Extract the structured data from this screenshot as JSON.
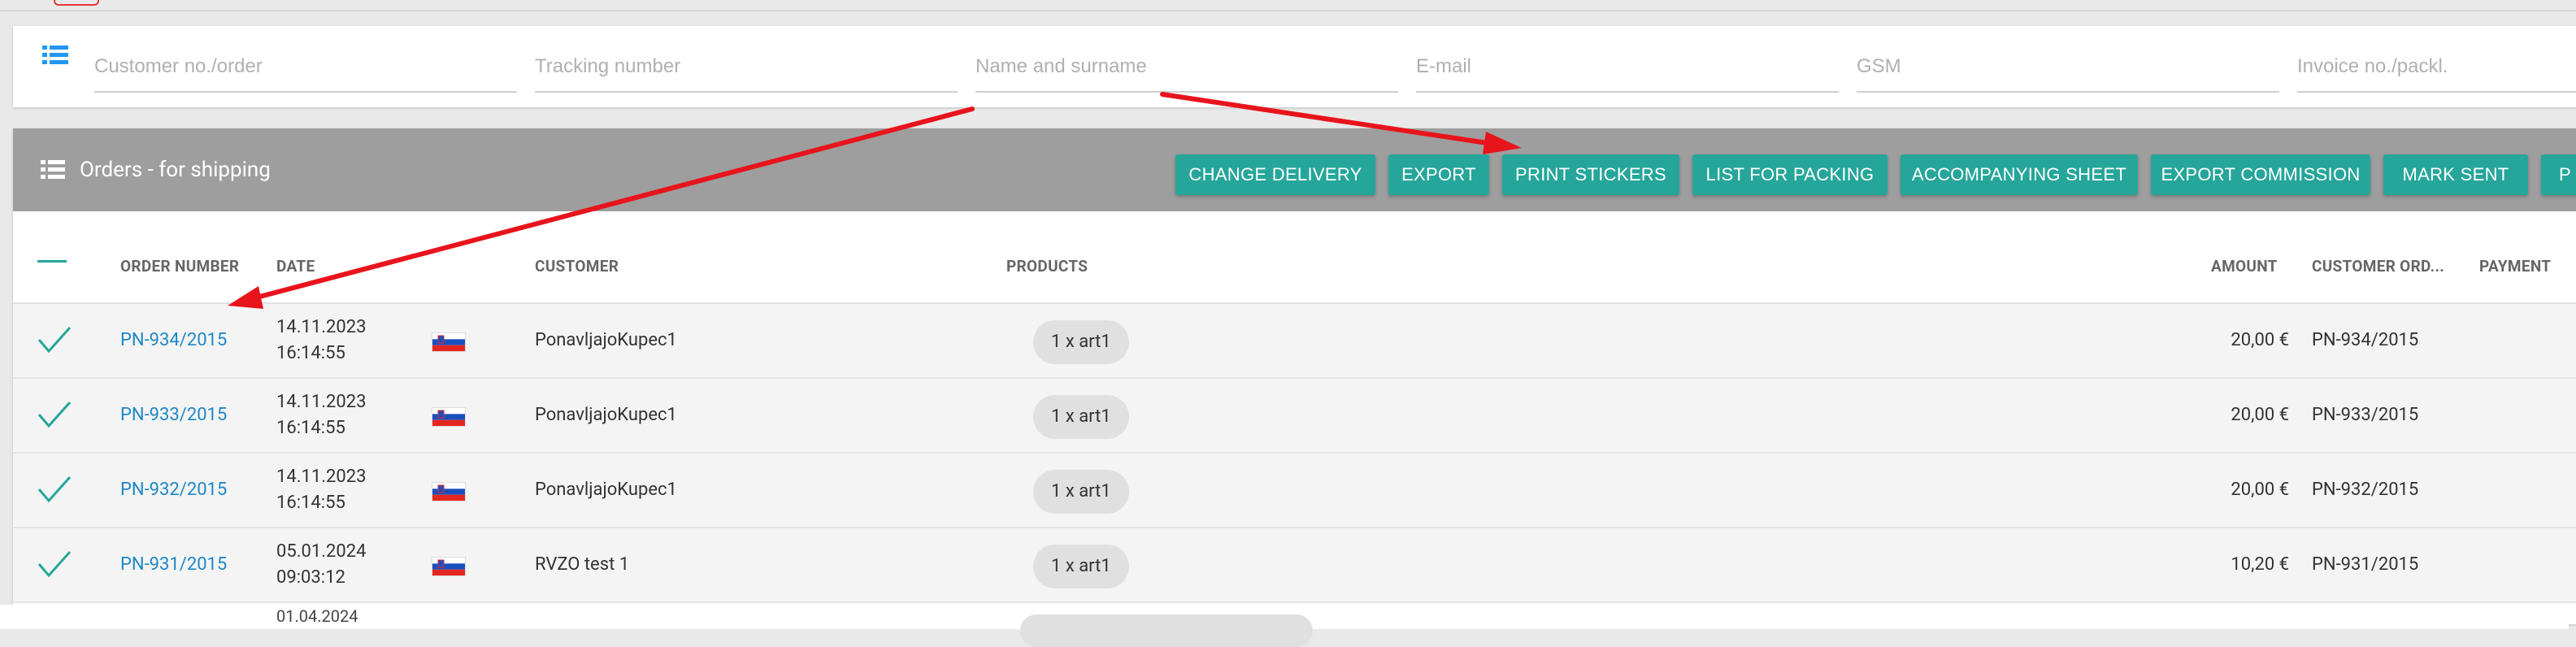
{
  "filters": {
    "placeholders": [
      "Customer no./order",
      "Tracking number",
      "Name and surname",
      "E-mail",
      "GSM",
      "Invoice no./packl."
    ]
  },
  "panel": {
    "title": "Orders - for shipping",
    "buttons": [
      "CHANGE DELIVERY",
      "EXPORT",
      "PRINT STICKERS",
      "LIST FOR PACKING",
      "ACCOMPANYING SHEET",
      "EXPORT COMMISSION",
      "MARK SENT",
      "P"
    ]
  },
  "table": {
    "headers": {
      "order_number": "ORDER NUMBER",
      "date": "DATE",
      "customer": "CUSTOMER",
      "products": "PRODUCTS",
      "amount": "AMOUNT",
      "customer_order": "CUSTOMER ORD...",
      "payment": "PAYMENT"
    },
    "rows": [
      {
        "order": "PN-934/2015",
        "date": "14.11.2023",
        "time": "16:14:55",
        "customer": "PonavljajoKupec1",
        "product": "1 x art1",
        "amount": "20,00 €",
        "customer_order": "PN-934/2015"
      },
      {
        "order": "PN-933/2015",
        "date": "14.11.2023",
        "time": "16:14:55",
        "customer": "PonavljajoKupec1",
        "product": "1 x art1",
        "amount": "20,00 €",
        "customer_order": "PN-933/2015"
      },
      {
        "order": "PN-932/2015",
        "date": "14.11.2023",
        "time": "16:14:55",
        "customer": "PonavljajoKupec1",
        "product": "1 x art1",
        "amount": "20,00 €",
        "customer_order": "PN-932/2015"
      },
      {
        "order": "PN-931/2015",
        "date": "05.01.2024",
        "time": "09:03:12",
        "customer": "RVZO test 1",
        "product": "1 x art1",
        "amount": "10,20 €",
        "customer_order": "PN-931/2015"
      }
    ],
    "partial_row_date": "01.04.2024"
  },
  "colors": {
    "accent": "#26a69a",
    "link": "#1e88c7",
    "header_bg": "#9e9e9e",
    "arrow": "#e8141b"
  },
  "icons": {
    "filter_icon": "list-icon",
    "panel_icon": "list-icon",
    "row_select": "check-icon",
    "flag": "slovenia-flag-icon"
  }
}
